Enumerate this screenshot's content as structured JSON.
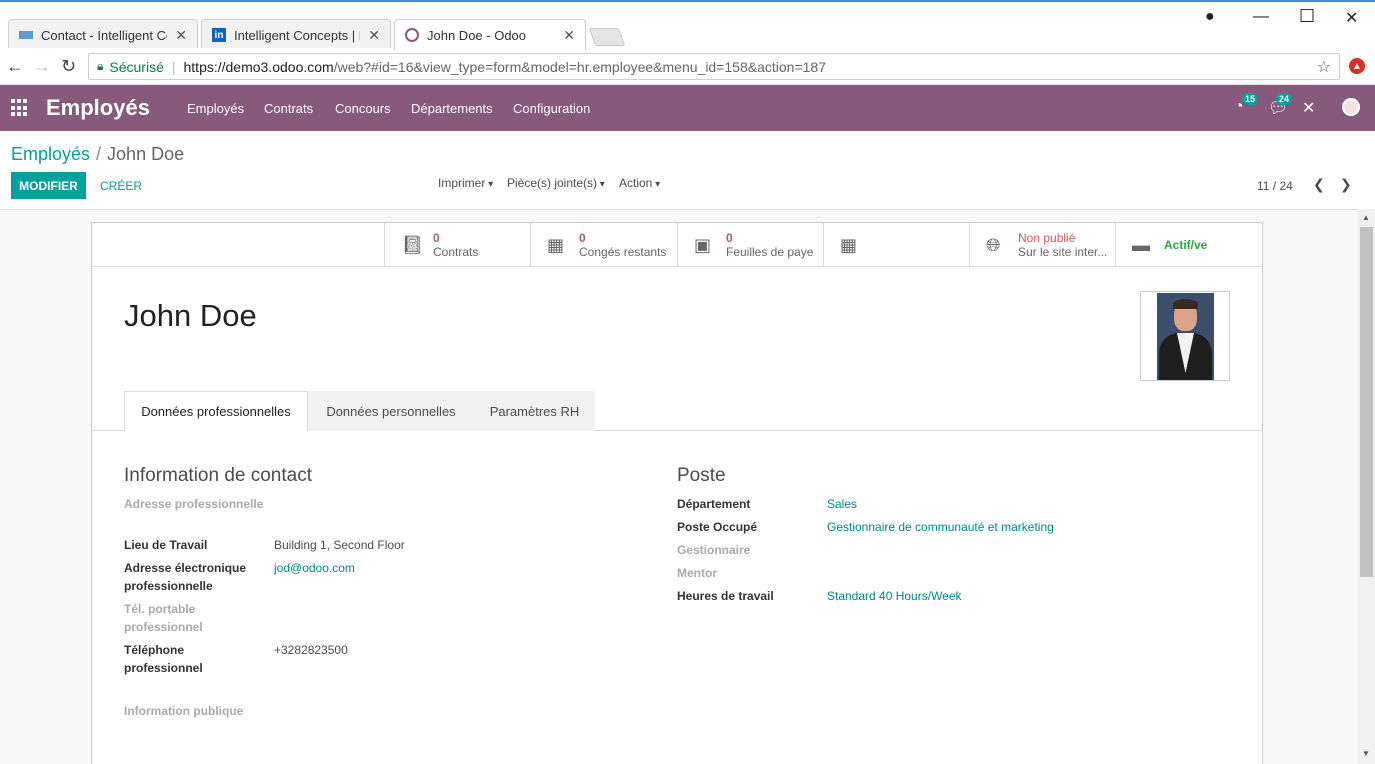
{
  "browser": {
    "tabs": [
      {
        "title": "Contact - Intelligent Con",
        "icon": "contact-page-icon"
      },
      {
        "title": "Intelligent Concepts | Lin",
        "icon": "linkedin-icon"
      },
      {
        "title": "John Doe - Odoo",
        "icon": "odoo-icon"
      }
    ],
    "secure_label": "Sécurisé",
    "url_main": "https://demo3.odoo.com",
    "url_rest": "/web?#id=16&view_type=form&model=hr.employee&menu_id=158&action=187"
  },
  "topmenu": {
    "brand": "Employés",
    "items": [
      "Employés",
      "Contrats",
      "Concours",
      "Départements",
      "Configuration"
    ],
    "activity_count": "15",
    "messages_count": "24"
  },
  "breadcrumb": {
    "parent": "Employés",
    "separator": "/",
    "current": "John Doe"
  },
  "actions": {
    "edit": "MODIFIER",
    "create": "CRÉER",
    "print": "Imprimer",
    "attachments": "Pièce(s) jointe(s)",
    "action": "Action"
  },
  "pager": {
    "value": "11 / 24"
  },
  "smart_buttons": [
    {
      "value": "0",
      "label": "Contrats",
      "icon": "book-icon"
    },
    {
      "value": "0",
      "label": "Congés restants",
      "icon": "calendar-icon"
    },
    {
      "value": "0",
      "label": "Feuilles de paye",
      "icon": "money-icon"
    },
    {
      "value": "",
      "label": "",
      "icon": "calendar-icon"
    },
    {
      "value": "Non publié",
      "label": "Sur le site inter...",
      "icon": "globe-icon"
    },
    {
      "value": "Actif/ve",
      "label": "",
      "icon": "archive-icon"
    }
  ],
  "employee": {
    "name": "John Doe"
  },
  "form_tabs": [
    "Données professionnelles",
    "Données personnelles",
    "Paramètres RH"
  ],
  "contact": {
    "title": "Information de contact",
    "work_address_label": "Adresse professionnelle",
    "work_location_label": "Lieu de Travail",
    "work_location_value": "Building 1, Second Floor",
    "work_email_label": "Adresse électronique professionnelle",
    "work_email_value": "jod@odoo.com",
    "mobile_label": "Tél. portable professionnel",
    "work_phone_label": "Téléphone professionnel",
    "work_phone_value": "+3282823500",
    "public_info_label": "Information publique"
  },
  "position": {
    "title": "Poste",
    "department_label": "Département",
    "department_value": "Sales",
    "job_label": "Poste Occupé",
    "job_value": "Gestionnaire de communauté et marketing",
    "manager_label": "Gestionnaire",
    "mentor_label": "Mentor",
    "hours_label": "Heures de travail",
    "hours_value": "Standard 40 Hours/Week"
  },
  "colors": {
    "brand": "#875a7b",
    "accent": "#00a09d",
    "warning": "#b1596d"
  }
}
